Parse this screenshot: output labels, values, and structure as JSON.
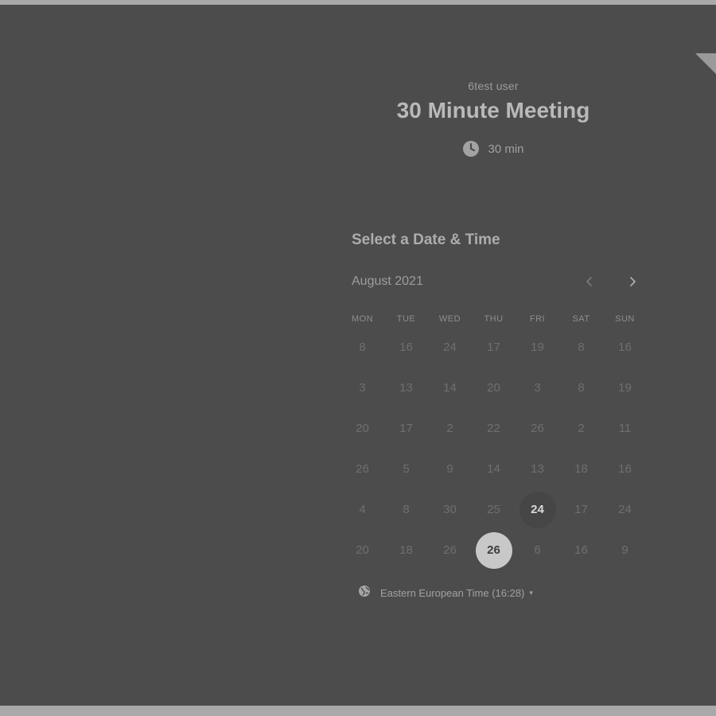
{
  "header": {
    "host_name": "6test user",
    "event_title": "30 Minute Meeting",
    "duration": "30 min",
    "duration_icon": "clock-icon"
  },
  "scheduler": {
    "title": "Select a Date & Time",
    "month_label": "August 2021",
    "prev_icon": "chevron-left-icon",
    "next_icon": "chevron-right-icon",
    "weekdays": [
      "MON",
      "TUE",
      "WED",
      "THU",
      "FRI",
      "SAT",
      "SUN"
    ],
    "weeks": [
      [
        "8",
        "16",
        "24",
        "17",
        "19",
        "8",
        "16"
      ],
      [
        "3",
        "13",
        "14",
        "20",
        "3",
        "8",
        "19"
      ],
      [
        "20",
        "17",
        "2",
        "22",
        "26",
        "2",
        "11"
      ],
      [
        "26",
        "5",
        "9",
        "14",
        "13",
        "18",
        "16"
      ],
      [
        "4",
        "8",
        "30",
        "25",
        "24",
        "17",
        "24"
      ],
      [
        "20",
        "18",
        "26",
        "26",
        "6",
        "16",
        "9"
      ]
    ],
    "available_day": "24",
    "selected_day": "26"
  },
  "timezone": {
    "icon": "globe-icon",
    "label": "Eastern European Time (16:28)",
    "caret": "▾"
  },
  "colors": {
    "overlay": "#4c4c4c",
    "selected_bg": "#c8c8c8",
    "text_dim": "#6f6f6f"
  }
}
